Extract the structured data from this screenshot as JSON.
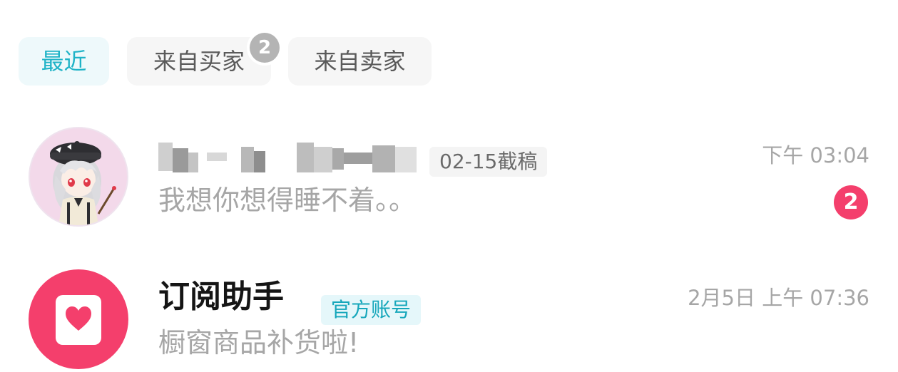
{
  "tabs": [
    {
      "label": "最近",
      "active": true
    },
    {
      "label": "来自买家",
      "badge": "2"
    },
    {
      "label": "来自卖家"
    }
  ],
  "conversations": [
    {
      "name": "",
      "tag": "02-15截稿",
      "preview": "我想你想得睡不着。。",
      "time": "下午 03:04",
      "unread": "2",
      "avatar": "anime-girl-avatar"
    },
    {
      "name": "订阅助手",
      "tag": "官方账号",
      "preview": "橱窗商品补货啦!",
      "time": "2月5日 上午 07:36",
      "avatar": "heart-card-icon"
    }
  ],
  "colors": {
    "accent": "#1fb3c7",
    "badge_red": "#f43f6c",
    "muted_text": "#a6a6a6"
  }
}
